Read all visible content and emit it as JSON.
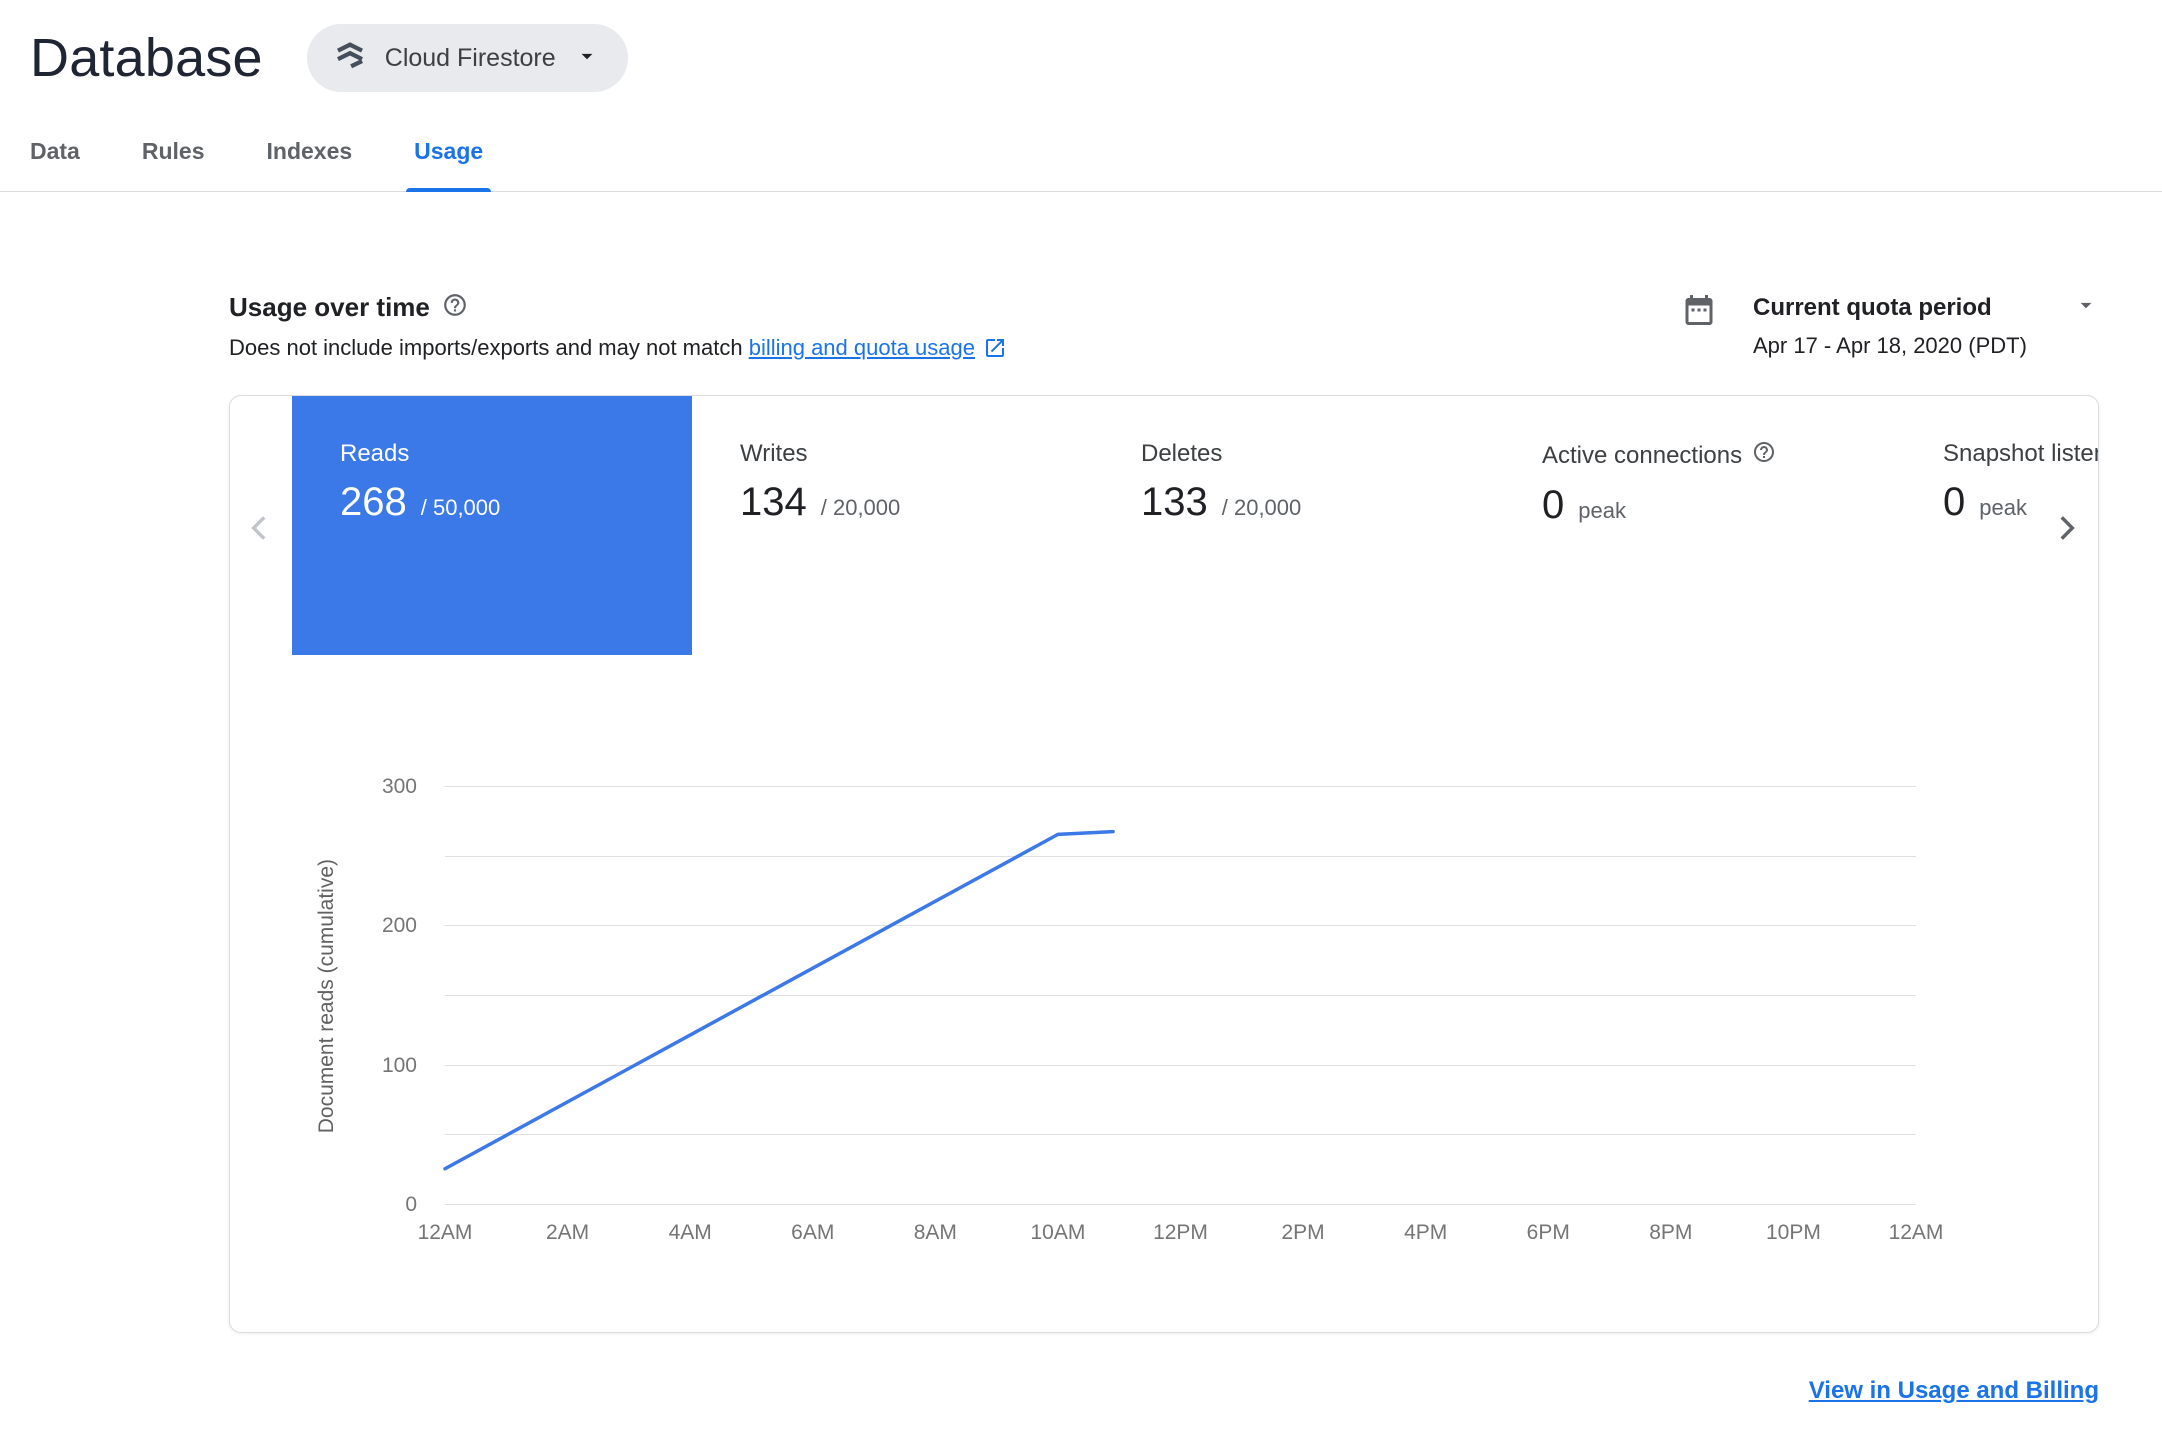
{
  "colors": {
    "accent": "#1a73e8",
    "selected_metric_blue": "#3b78e8",
    "chart_line_blue": "#3b78e8",
    "tab_inactive_gray": "#5f6368"
  },
  "header": {
    "title": "Database",
    "product": "Cloud Firestore"
  },
  "tabs": [
    {
      "label": "Data",
      "active": false
    },
    {
      "label": "Rules",
      "active": false
    },
    {
      "label": "Indexes",
      "active": false
    },
    {
      "label": "Usage",
      "active": true
    }
  ],
  "usage": {
    "heading": "Usage over time",
    "desc_prefix": "Does not include imports/exports and may not match ",
    "desc_link": "billing and quota usage",
    "period": {
      "label": "Current quota period",
      "range": "Apr 17 - Apr 18, 2020 (PDT)"
    }
  },
  "metrics": [
    {
      "label": "Reads",
      "value": "268",
      "quota": "/ 50,000",
      "selected": true
    },
    {
      "label": "Writes",
      "value": "134",
      "quota": "/ 20,000",
      "selected": false
    },
    {
      "label": "Deletes",
      "value": "133",
      "quota": "/ 20,000",
      "selected": false
    },
    {
      "label": "Active connections",
      "value": "0",
      "quota": "peak",
      "selected": false
    },
    {
      "label": "Snapshot listeners",
      "value": "0",
      "quota": "peak",
      "selected": false
    }
  ],
  "footer_link": "View in Usage and Billing",
  "chart_data": {
    "type": "line",
    "title": "",
    "xlabel": "",
    "ylabel": "Document reads (cumulative)",
    "ylim": [
      0,
      300
    ],
    "gridline_step": 50,
    "labeled_y_ticks": [
      0,
      100,
      200,
      300
    ],
    "x_domain_hours": [
      0,
      24
    ],
    "x_tick_labels": [
      "12AM",
      "2AM",
      "4AM",
      "6AM",
      "8AM",
      "10AM",
      "12PM",
      "2PM",
      "4PM",
      "6PM",
      "8PM",
      "10PM",
      "12AM"
    ],
    "grid": "horizontal",
    "legend": "none",
    "series": [
      {
        "name": "Reads (cumulative)",
        "color": "#3b78e8",
        "points": [
          [
            0,
            26
          ],
          [
            10,
            266
          ],
          [
            10.9,
            268
          ]
        ]
      }
    ]
  }
}
